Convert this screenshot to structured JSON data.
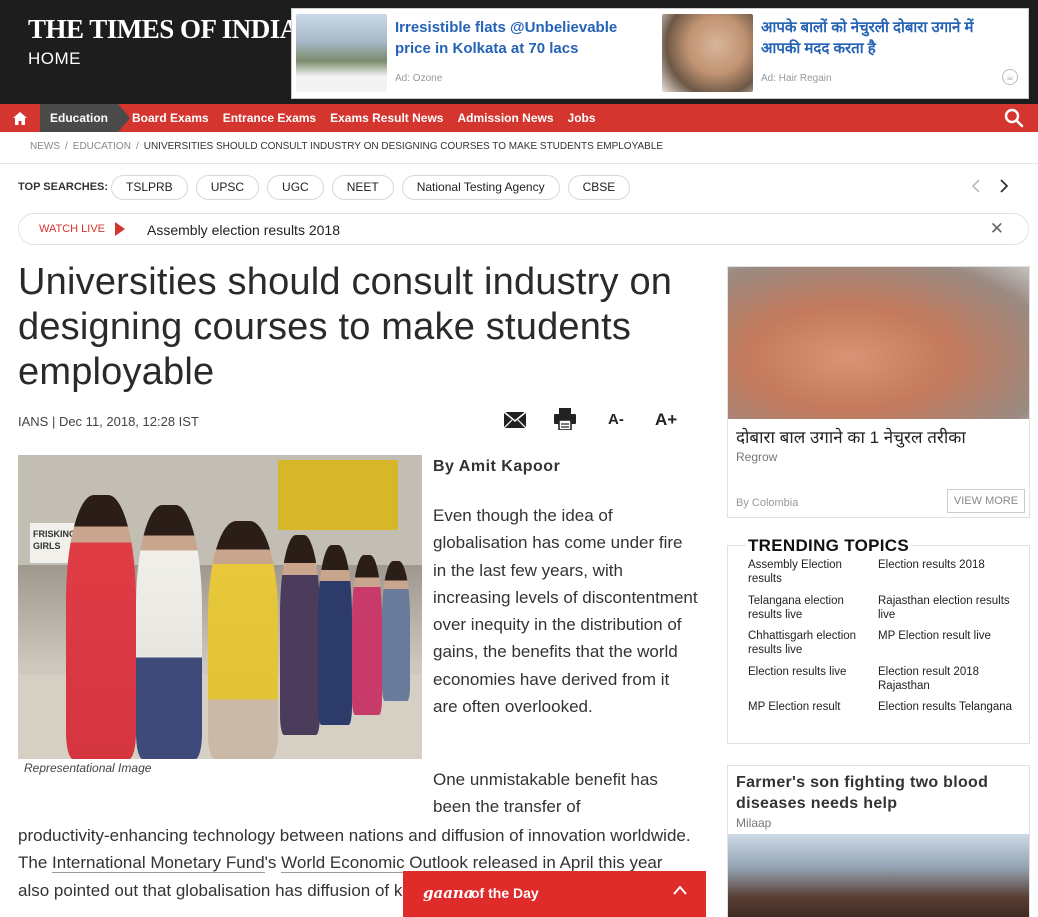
{
  "header": {
    "logo_text": "THE TIMES OF INDIA",
    "section": "HOME",
    "ads": [
      {
        "title": "Irresistible flats @Unbelievable price in Kolkata at 70 lacs",
        "meta": "Ad: Ozone"
      },
      {
        "title": "आपके बालों को नेचुरली दोबारा उगाने में आपकी मदद करता है",
        "meta": "Ad: Hair Regain"
      }
    ]
  },
  "nav": {
    "active": "Education",
    "items": [
      "Board Exams",
      "Entrance Exams",
      "Exams Result News",
      "Admission News",
      "Jobs"
    ]
  },
  "breadcrumb": {
    "items": [
      "NEWS",
      "EDUCATION"
    ],
    "current": "UNIVERSITIES SHOULD CONSULT INDUSTRY ON DESIGNING COURSES TO MAKE STUDENTS EMPLOYABLE"
  },
  "top_searches": {
    "label": "TOP SEARCHES:",
    "items": [
      "TSLPRB",
      "UPSC",
      "UGC",
      "NEET",
      "National Testing Agency",
      "CBSE"
    ]
  },
  "watch_live": {
    "label": "WATCH LIVE",
    "text": "Assembly election results 2018"
  },
  "article": {
    "headline": "Universities should consult industry on designing courses to make students employable",
    "source_date": "IANS | Dec 11, 2018, 12:28 IST",
    "font_decrease": "A-",
    "font_increase": "A+",
    "image_sign": "FRISKING GIRLS",
    "caption": "Representational Image",
    "author": "By Amit Kapoor",
    "para1": "Even though the idea of globalisation has come under fire in the last few years, with increasing levels of discontentment over inequity in the distribution of gains, the benefits that the world economies have derived from it are often overlooked.",
    "para2_start": "One unmistakable benefit has been the transfer of",
    "para2_full_a": "productivity-enhancing technology between nations and diffusion of innovation worldwide. The ",
    "para2_link1": "International Monetary Fund",
    "para2_mid": "'s ",
    "para2_link2": "World Economic Outlook",
    "para2_full_b": " released in April this year also pointed out that globalisation has ",
    "para2_full_c": "diffusion of knowledge and technology across the"
  },
  "sidebar": {
    "ad1": {
      "title": "दोबारा बाल उगाने का 1 नेचुरल तरीका",
      "source": "Regrow",
      "by": "By Colombia",
      "view_more": "VIEW MORE"
    },
    "trending": {
      "title": "TRENDING TOPICS",
      "items": [
        "Assembly Election results",
        "Election results 2018",
        "Telangana election results live",
        "Rajasthan election results live",
        "Chhattisgarh election results live",
        "MP Election result live",
        "Election results live",
        "Election result 2018 Rajasthan",
        "MP Election result",
        "Election results Telangana"
      ]
    },
    "ad2": {
      "title": "Farmer's son fighting two blood diseases needs help",
      "source": "Milaap"
    }
  },
  "gaana": {
    "logo": "gaana",
    "text": "of the Day"
  },
  "colors": {
    "nav_red": "#d4352f",
    "header_dark": "#1d1d1d",
    "ad_link_blue": "#2563b6"
  }
}
